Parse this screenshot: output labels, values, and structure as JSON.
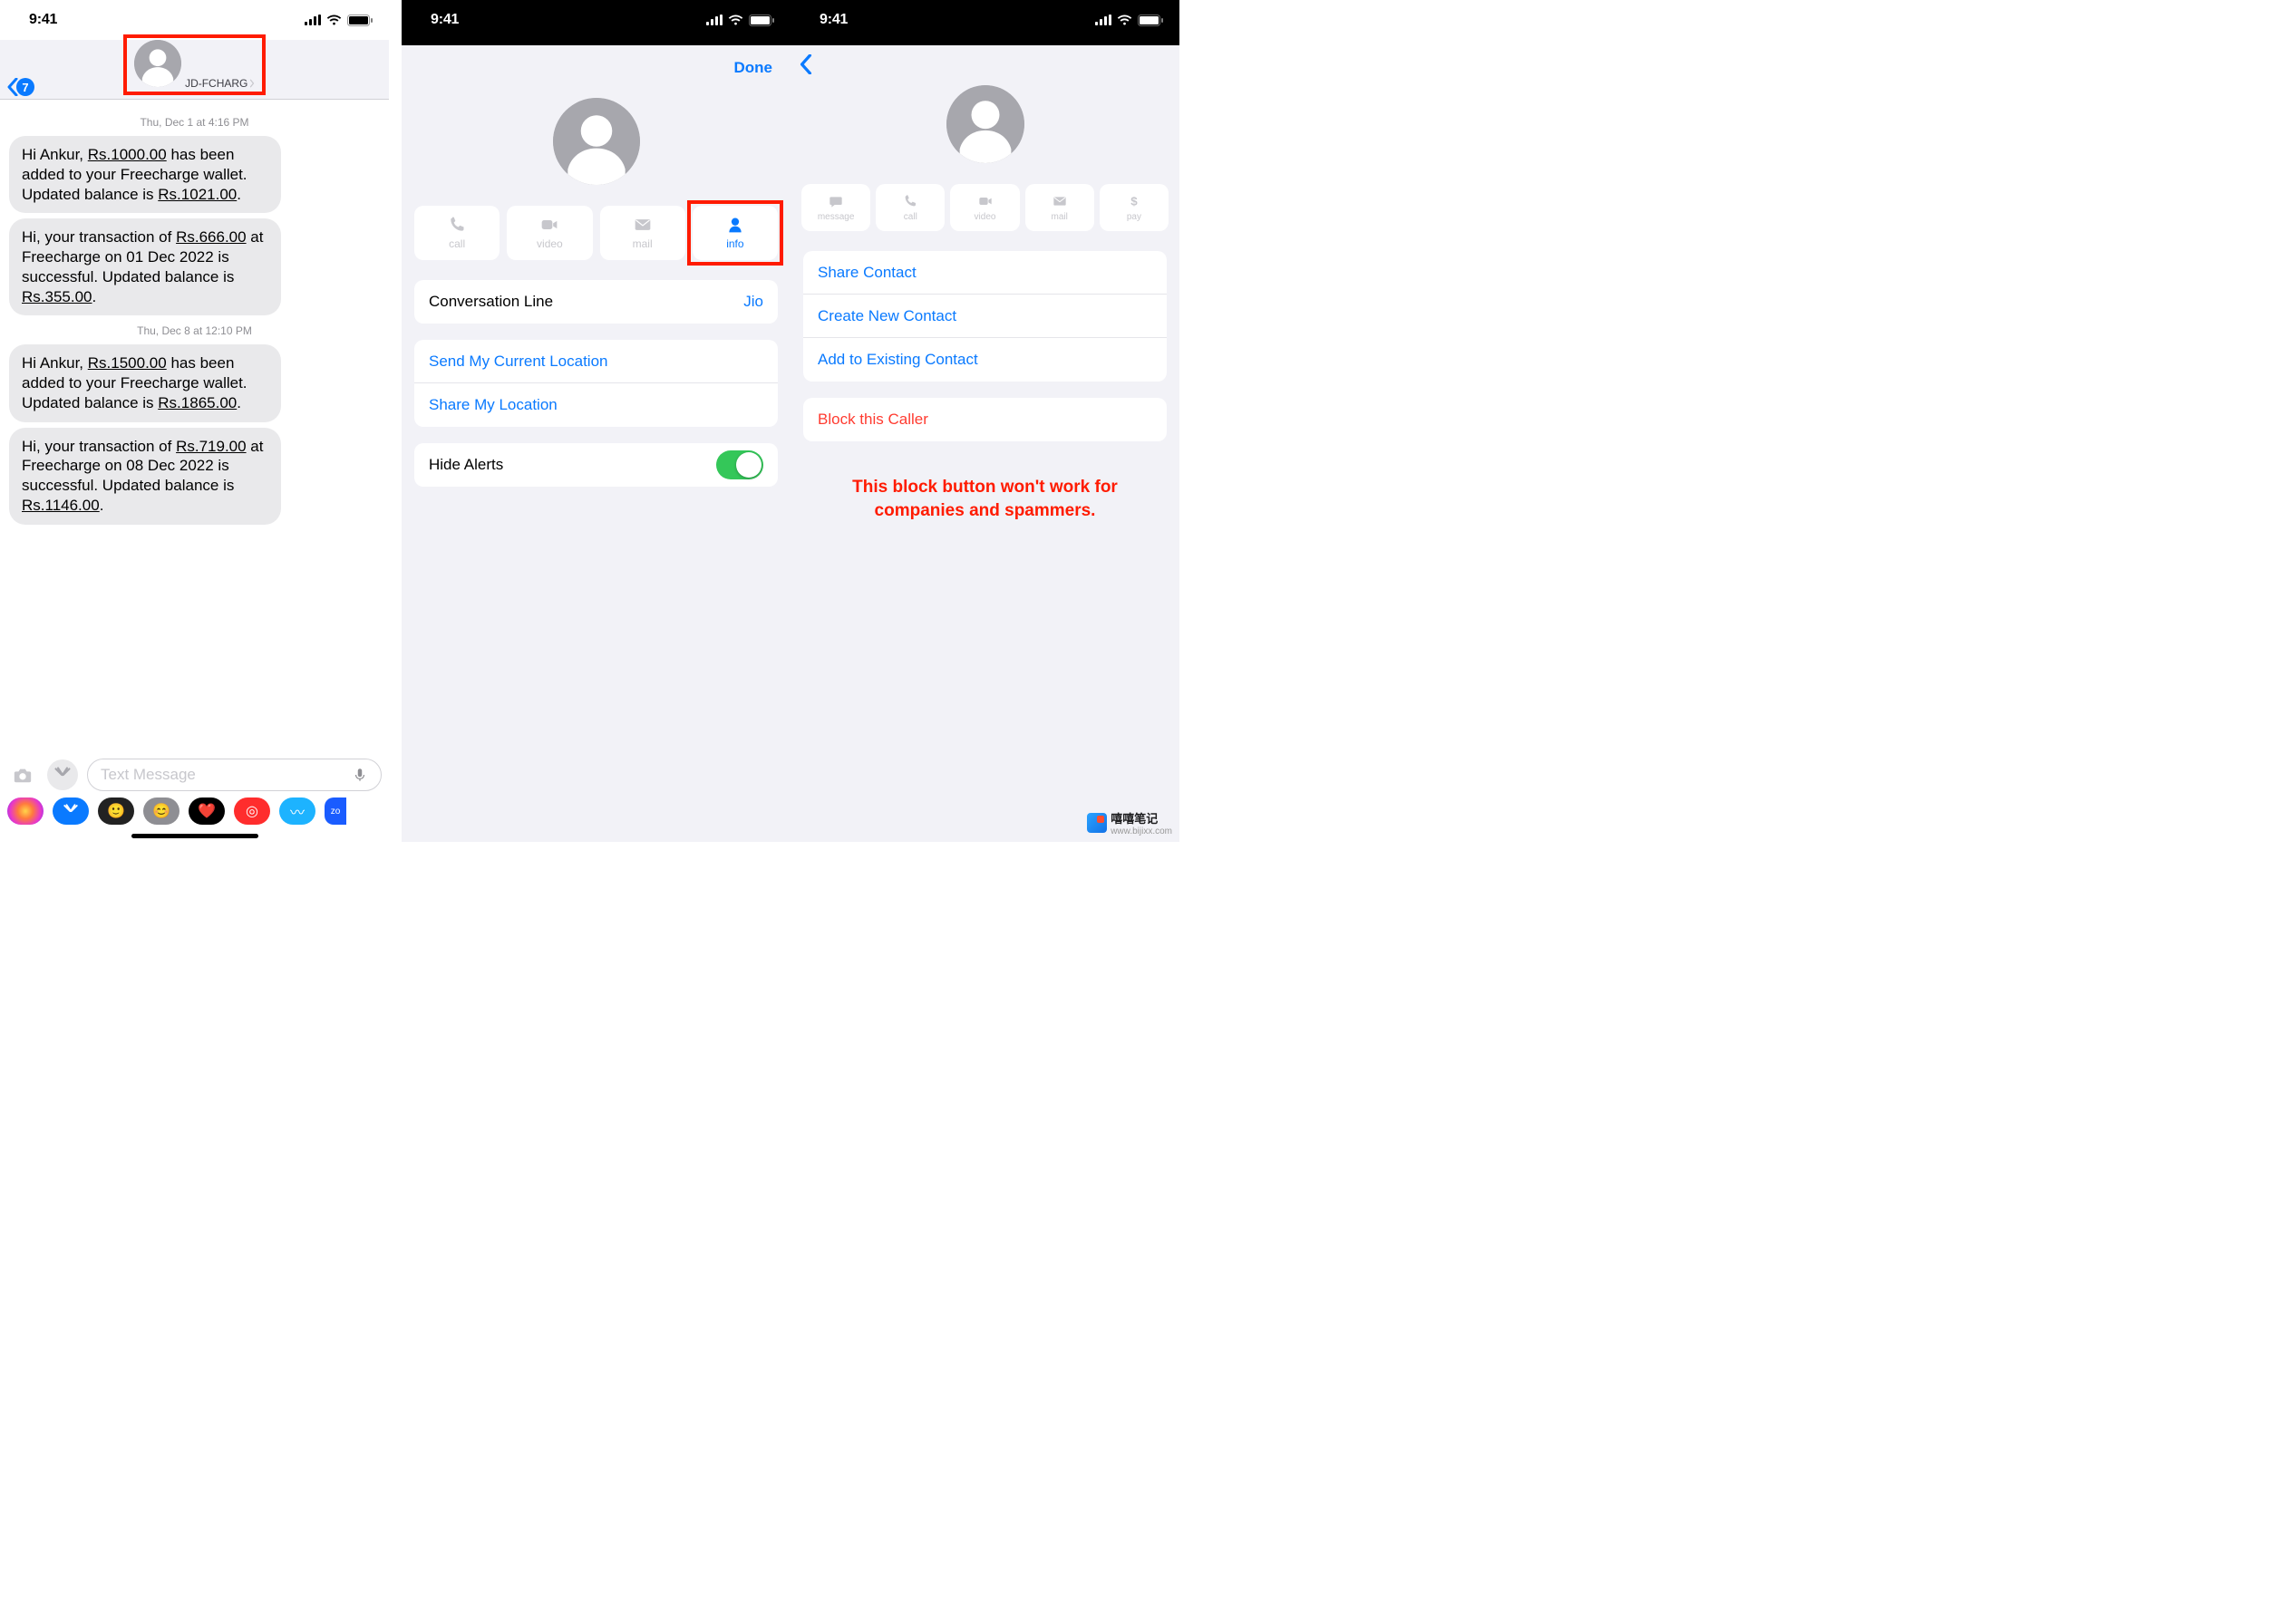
{
  "status": {
    "time": "9:41"
  },
  "s1": {
    "back_count": "7",
    "contact_name": "JD-FCHARG",
    "ts1": "Thu, Dec 1 at 4:16 PM",
    "m1a": "Hi Ankur, ",
    "m1b": "Rs.1000.00",
    "m1c": " has been added to your Freecharge wallet. Updated balance is ",
    "m1d": "Rs.1021.00",
    "m1e": ".",
    "m2a": "Hi, your transaction of ",
    "m2b": "Rs.666.00",
    "m2c": " at Freecharge on 01 Dec 2022 is successful. Updated balance is ",
    "m2d": "Rs.355.00",
    "m2e": ".",
    "ts2": "Thu, Dec 8 at 12:10 PM",
    "m3a": "Hi Ankur, ",
    "m3b": "Rs.1500.00",
    "m3c": " has been added to your Freecharge wallet. Updated balance is ",
    "m3d": "Rs.1865.00",
    "m3e": ".",
    "m4a": "Hi, your transaction of ",
    "m4b": "Rs.719.00",
    "m4c": " at Freecharge on 08 Dec 2022 is successful. Updated balance is ",
    "m4d": "Rs.1146.00",
    "m4e": ".",
    "placeholder": "Text Message"
  },
  "s2": {
    "done": "Done",
    "act_call": "call",
    "act_video": "video",
    "act_mail": "mail",
    "act_info": "info",
    "conv_line_label": "Conversation Line",
    "conv_line_value": "Jio",
    "send_loc": "Send My Current Location",
    "share_loc": "Share My Location",
    "hide_alerts": "Hide Alerts"
  },
  "s3": {
    "act_message": "message",
    "act_call": "call",
    "act_video": "video",
    "act_mail": "mail",
    "act_pay": "pay",
    "share_contact": "Share Contact",
    "create_contact": "Create New Contact",
    "add_contact": "Add to Existing Contact",
    "block": "Block this Caller",
    "note": "This block button won't work for companies and spammers."
  },
  "watermark": {
    "name": "嘻嘻笔记",
    "url": "www.bijixx.com"
  }
}
